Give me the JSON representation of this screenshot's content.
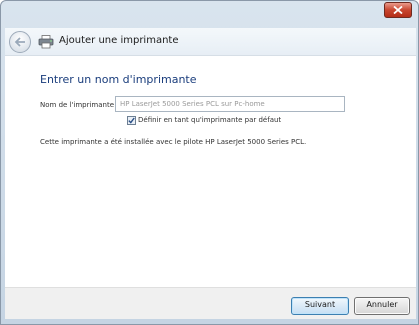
{
  "window": {
    "close_icon": "close-icon"
  },
  "header": {
    "back_icon": "back-arrow-icon",
    "app_icon": "printer-icon",
    "title": "Ajouter une imprimante"
  },
  "main": {
    "title": "Entrer un nom d'imprimante",
    "name_label": "Nom de l'imprimante :",
    "name_value": "HP LaserJet 5000 Series PCL sur Pc-home",
    "default_checkbox": {
      "checked": true,
      "label": "Définir en tant qu'imprimante par défaut"
    },
    "info": "Cette imprimante a été installée avec le pilote HP LaserJet 5000 Series PCL."
  },
  "footer": {
    "next_label": "Suivant",
    "cancel_label": "Annuler"
  },
  "colors": {
    "title_blue": "#1a3d7c",
    "close_red": "#c8462f"
  }
}
